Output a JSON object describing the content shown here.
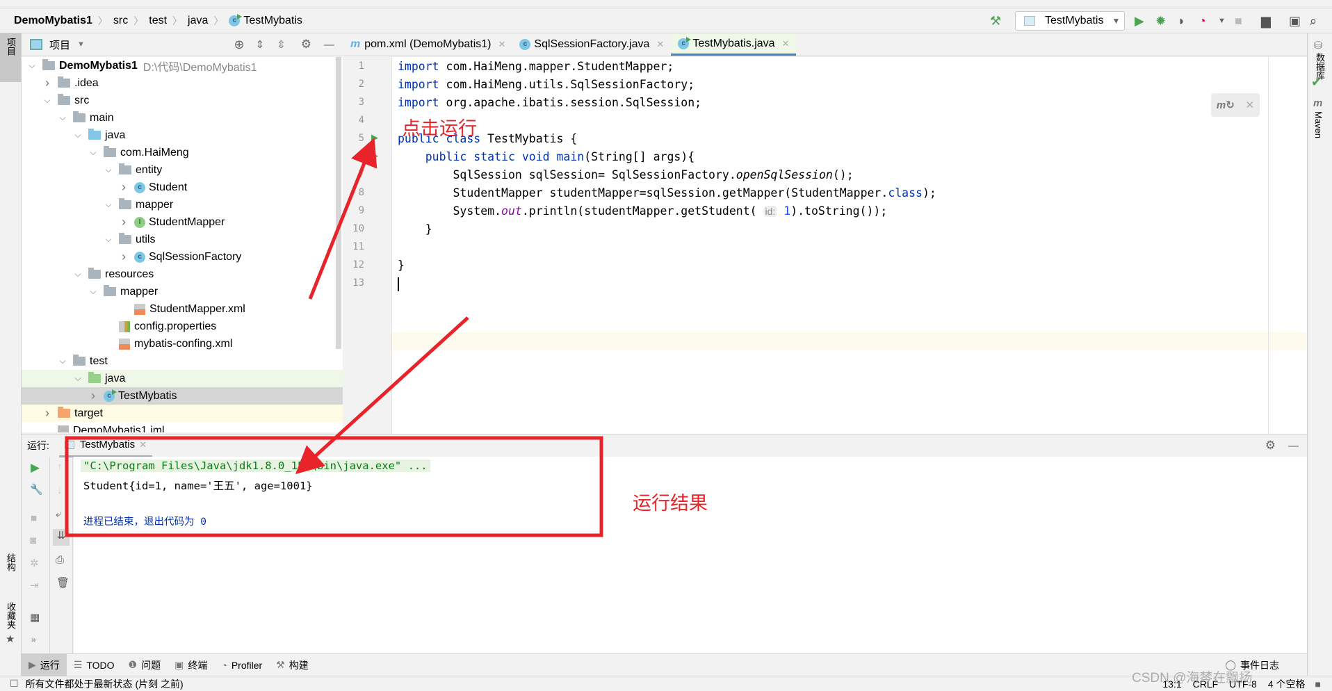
{
  "breadcrumb": [
    "DemoMybatis1",
    "src",
    "test",
    "java",
    "TestMybatis"
  ],
  "run_config": "TestMybatis",
  "project_panel": {
    "title": "项目",
    "root_path": "D:\\代码\\DemoMybatis1"
  },
  "left_strip": [
    "项目",
    "结构",
    "收藏夹"
  ],
  "right_strip": [
    "数据库",
    "Maven"
  ],
  "tree": [
    {
      "label": "DemoMybatis1",
      "level": 0,
      "arrow": "down",
      "icon": "module",
      "bold": true
    },
    {
      "label": ".idea",
      "level": 1,
      "arrow": "right",
      "icon": "folder"
    },
    {
      "label": "src",
      "level": 1,
      "arrow": "down",
      "icon": "folder"
    },
    {
      "label": "main",
      "level": 2,
      "arrow": "down",
      "icon": "folder"
    },
    {
      "label": "java",
      "level": 3,
      "arrow": "down",
      "icon": "folder-source"
    },
    {
      "label": "com.HaiMeng",
      "level": 4,
      "arrow": "down",
      "icon": "package"
    },
    {
      "label": "entity",
      "level": 5,
      "arrow": "down",
      "icon": "package"
    },
    {
      "label": "Student",
      "level": 6,
      "arrow": "right",
      "icon": "class"
    },
    {
      "label": "mapper",
      "level": 5,
      "arrow": "down",
      "icon": "package"
    },
    {
      "label": "StudentMapper",
      "level": 6,
      "arrow": "right",
      "icon": "interface"
    },
    {
      "label": "utils",
      "level": 5,
      "arrow": "down",
      "icon": "package"
    },
    {
      "label": "SqlSessionFactory",
      "level": 6,
      "arrow": "right",
      "icon": "class"
    },
    {
      "label": "resources",
      "level": 3,
      "arrow": "down",
      "icon": "folder-resources"
    },
    {
      "label": "mapper",
      "level": 4,
      "arrow": "down",
      "icon": "folder"
    },
    {
      "label": "StudentMapper.xml",
      "level": 6,
      "arrow": "",
      "icon": "xml"
    },
    {
      "label": "config.properties",
      "level": 5,
      "arrow": "",
      "icon": "properties"
    },
    {
      "label": "mybatis-confing.xml",
      "level": 5,
      "arrow": "",
      "icon": "xml"
    },
    {
      "label": "test",
      "level": 2,
      "arrow": "down",
      "icon": "folder"
    },
    {
      "label": "java",
      "level": 3,
      "arrow": "down",
      "icon": "folder-test",
      "highlight": "#eff8e8"
    },
    {
      "label": "TestMybatis",
      "level": 4,
      "arrow": "right",
      "icon": "class-run",
      "highlight": "#d5d5d5"
    },
    {
      "label": "target",
      "level": 1,
      "arrow": "right",
      "icon": "folder-excluded",
      "highlight": "#fdfbe3"
    },
    {
      "label": "DemoMybatis1.iml",
      "level": 1,
      "arrow": "",
      "icon": "iml"
    }
  ],
  "tabs": [
    {
      "label": "pom.xml (DemoMybatis1)",
      "icon": "maven-icon"
    },
    {
      "label": "SqlSessionFactory.java",
      "icon": "class-icon"
    },
    {
      "label": "TestMybatis.java",
      "icon": "class-run-icon",
      "active": true
    }
  ],
  "code": [
    [
      [
        "import",
        "kw"
      ],
      [
        " com.HaiMeng.mapper.StudentMapper;",
        ""
      ]
    ],
    [
      [
        "import",
        "kw"
      ],
      [
        " com.HaiMeng.utils.SqlSessionFactory;",
        ""
      ]
    ],
    [
      [
        "import",
        "kw"
      ],
      [
        " org.apache.ibatis.session.SqlSession;",
        ""
      ]
    ],
    [],
    [
      [
        "public class",
        "kw"
      ],
      [
        " TestMybatis {",
        ""
      ]
    ],
    [
      [
        "    ",
        ""
      ],
      [
        "public static void",
        "kw"
      ],
      [
        " ",
        ""
      ],
      [
        "main",
        "kw"
      ],
      [
        "(String[] args){",
        ""
      ]
    ],
    [
      [
        "        SqlSession sqlSession= SqlSessionFactory.",
        ""
      ],
      [
        "openSqlSession",
        "it"
      ],
      [
        "();",
        ""
      ]
    ],
    [
      [
        "        StudentMapper studentMapper=sqlSession.getMapper(StudentMapper.",
        ""
      ],
      [
        "class",
        "kw"
      ],
      [
        ");",
        ""
      ]
    ],
    [
      [
        "        System.",
        ""
      ],
      [
        "out",
        "st"
      ],
      [
        ".println(studentMapper.getStudent( ",
        ""
      ],
      [
        "id:",
        "hint"
      ],
      [
        " ",
        ""
      ],
      [
        "1",
        "num"
      ],
      [
        ").toString());",
        ""
      ]
    ],
    [
      [
        "    }",
        ""
      ]
    ],
    [],
    [
      [
        "}",
        ""
      ]
    ],
    []
  ],
  "run_panel": {
    "label": "运行:",
    "tab": "TestMybatis",
    "lines": [
      {
        "text": "\"C:\\Program Files\\Java\\jdk1.8.0_152\\bin\\java.exe\" ...",
        "color": "#067d17",
        "bg": "#e8f2e0"
      },
      {
        "text": "Student{id=1, name='王五', age=1001}",
        "color": "#000"
      },
      {
        "text": "进程已结束，退出代码为 0",
        "color": "#0033b3"
      }
    ]
  },
  "bottom_tools": [
    "运行",
    "TODO",
    "问题",
    "终端",
    "Profiler",
    "构建"
  ],
  "event_log": "事件日志",
  "status": {
    "message": "所有文件都处于最新状态 (片刻 之前)",
    "position": "13:1",
    "line_sep": "CRLF",
    "encoding": "UTF-8",
    "indent": "4 个空格"
  },
  "annotations": {
    "click_run": "点击运行",
    "run_result": "运行结果",
    "watermark": "CSDN @海棽在飘扬"
  },
  "colors": {
    "annotation": "#e8232a",
    "accent": "#4083c9",
    "run_green": "#4aa452"
  }
}
